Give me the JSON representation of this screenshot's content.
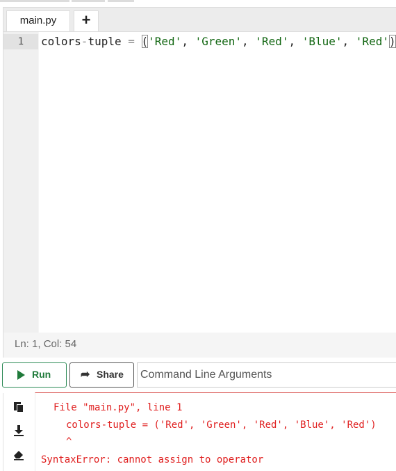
{
  "tabs": {
    "file_name": "main.py",
    "add_label": "+"
  },
  "editor": {
    "line_number": "1",
    "code_tokens": {
      "var1": "colors",
      "op1": "-",
      "var2": "tuple",
      "op2": " = ",
      "paren_open": "(",
      "s1": "'Red'",
      "c1": ", ",
      "s2": "'Green'",
      "c2": ", ",
      "s3": "'Red'",
      "c3": ", ",
      "s4": "'Blue'",
      "c4": ", ",
      "s5": "'Red'",
      "paren_close": ")"
    }
  },
  "status": {
    "position": "Ln: 1,  Col: 54"
  },
  "toolbar": {
    "run_label": "Run",
    "share_label": "Share",
    "args_placeholder": "Command Line Arguments"
  },
  "output": {
    "icons": [
      "copy-icon",
      "download-icon",
      "eraser-icon"
    ],
    "lines": [
      "File \"main.py\", line 1",
      "colors-tuple = ('Red', 'Green', 'Red', 'Blue', 'Red')",
      "^",
      "SyntaxError: cannot assign to operator"
    ]
  },
  "colors": {
    "run_accent": "#1f7a3a",
    "error_text": "#e02020",
    "string_token": "#116611"
  }
}
